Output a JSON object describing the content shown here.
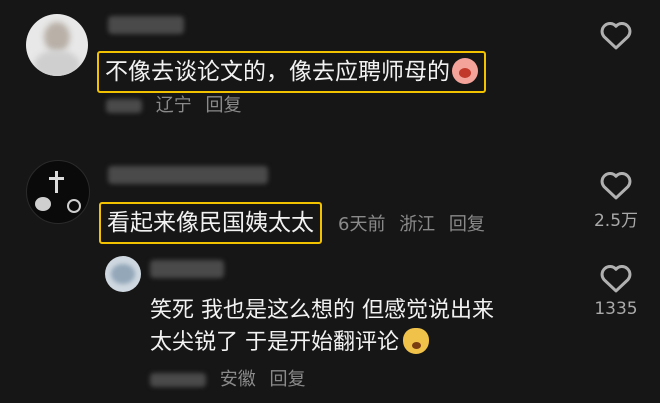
{
  "comment1": {
    "text": "不像去谈论文的，像去应聘师母的",
    "location": "辽宁",
    "reply_label": "回复",
    "likes": ""
  },
  "comment2": {
    "text": "看起来像民国姨太太",
    "time": "6天前",
    "location": "浙江",
    "reply_label": "回复",
    "likes": "2.5万"
  },
  "reply1": {
    "line1": "笑死 我也是这么想的 但感觉说出来",
    "line2": "太尖锐了 于是开始翻评论",
    "location": "安徽",
    "reply_label": "回复",
    "likes": "1335"
  },
  "colors": {
    "highlight": "#f2c200",
    "background": "#161616"
  },
  "icons": [
    "heart-outline-icon",
    "crying-face-emoji",
    "cheeky-face-emoji"
  ]
}
